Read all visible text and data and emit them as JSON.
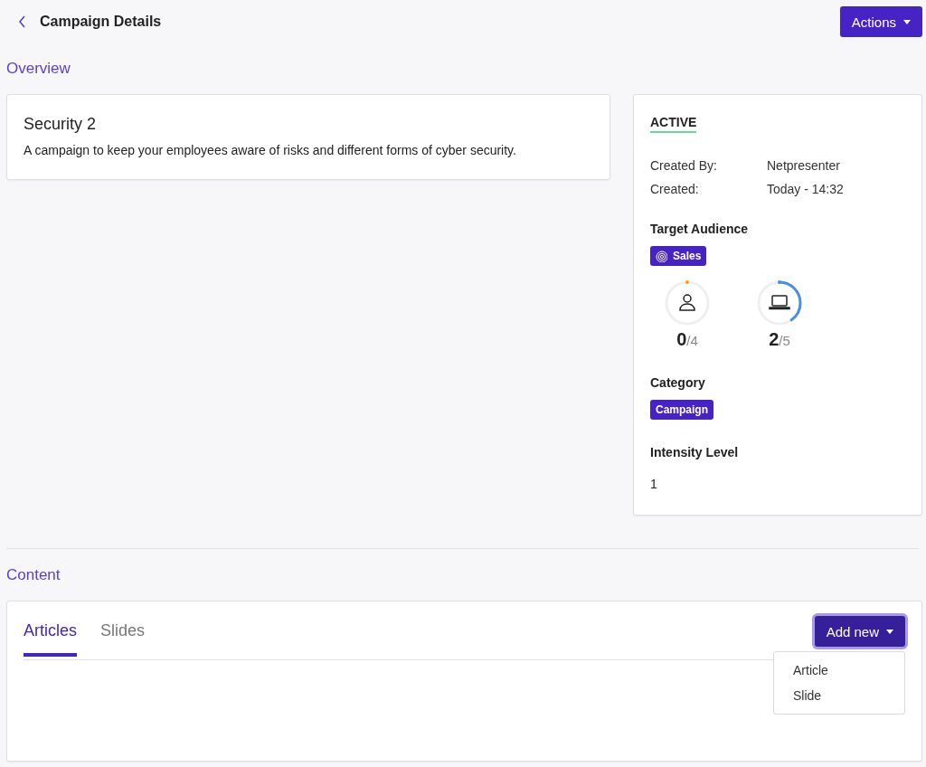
{
  "header": {
    "title": "Campaign Details",
    "actions_label": "Actions"
  },
  "overview": {
    "heading": "Overview",
    "name": "Security 2",
    "description": "A campaign to keep your employees aware of risks and different forms of cyber security."
  },
  "details": {
    "status": "ACTIVE",
    "fields": [
      {
        "label": "Created By:",
        "value": "Netpresenter"
      },
      {
        "label": "Created:",
        "value": "Today - 14:32"
      }
    ],
    "target_heading": "Target Audience",
    "target_tag": "Sales",
    "rings": [
      {
        "kind": "person",
        "level": 0,
        "color": "#f5a623",
        "count": "0",
        "total": "/4"
      },
      {
        "kind": "laptop",
        "level": 0.4,
        "color": "#4a90e2",
        "count": "2",
        "total": "/5"
      }
    ],
    "category_heading": "Category",
    "category_tag": "Campaign",
    "intensity_heading": "Intensity Level",
    "intensity_value": "1"
  },
  "content": {
    "heading": "Content",
    "tabs": [
      {
        "label": "Articles",
        "selected": true
      },
      {
        "label": "Slides",
        "selected": false
      }
    ],
    "add_label": "Add new",
    "menu_open": true,
    "menu": [
      "Article",
      "Slide"
    ]
  }
}
